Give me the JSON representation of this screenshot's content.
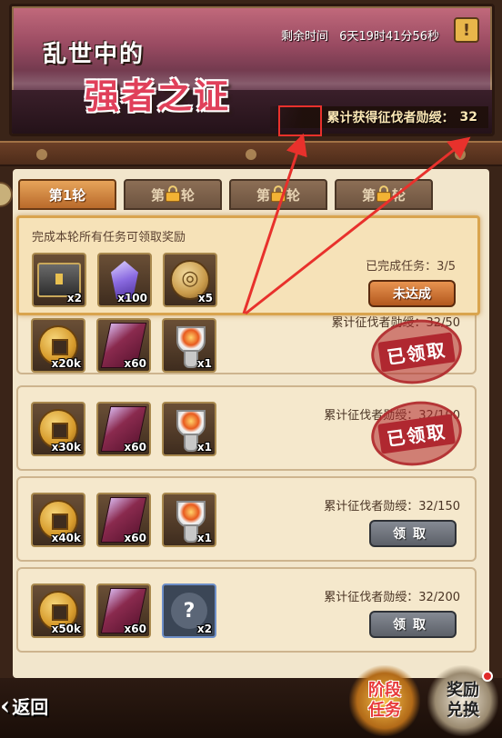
{
  "banner": {
    "title_line1": "乱世中的",
    "title_line2": "强者之证",
    "timer_label": "剩余时间",
    "timer_value": "6天19时41分56秒",
    "alert_icon": "!",
    "merit_label": "累计获得征伐者勋绶：",
    "merit_value": "32"
  },
  "tabs": [
    {
      "label": "第1轮",
      "locked": false
    },
    {
      "label": "第",
      "suffix": "轮",
      "locked": true
    },
    {
      "label": "第",
      "suffix": "轮",
      "locked": true
    },
    {
      "label": "第",
      "suffix": "轮",
      "locked": true
    }
  ],
  "summary": {
    "title": "完成本轮所有任务可领取奖励",
    "progress": "已完成任务：3/5",
    "button": "未达成",
    "items": [
      {
        "icon": "chest-icon",
        "qty": "x2"
      },
      {
        "icon": "crystal-icon",
        "qty": "x100"
      },
      {
        "icon": "token-icon",
        "qty": "x5"
      }
    ]
  },
  "tasks": [
    {
      "label": "累计征伐者勋绶：32/50",
      "status": "claimed",
      "stamp": "已领取",
      "items": [
        {
          "icon": "coin-icon",
          "qty": "x20k"
        },
        {
          "icon": "scroll-icon",
          "qty": "x60"
        },
        {
          "icon": "cup-icon",
          "qty": "x1"
        }
      ]
    },
    {
      "label": "累计征伐者勋绶：32/100",
      "status": "claimed",
      "stamp": "已领取",
      "items": [
        {
          "icon": "coin-icon",
          "qty": "x30k"
        },
        {
          "icon": "scroll-icon",
          "qty": "x60"
        },
        {
          "icon": "cup-icon",
          "qty": "x1"
        }
      ]
    },
    {
      "label": "累计征伐者勋绶：32/150",
      "status": "locked",
      "button": "领取",
      "items": [
        {
          "icon": "coin-icon",
          "qty": "x40k"
        },
        {
          "icon": "scroll-icon",
          "qty": "x60"
        },
        {
          "icon": "cup-icon",
          "qty": "x1"
        }
      ]
    },
    {
      "label": "累计征伐者勋绶：32/200",
      "status": "locked",
      "button": "领取",
      "items": [
        {
          "icon": "coin-icon",
          "qty": "x50k"
        },
        {
          "icon": "scroll-icon",
          "qty": "x60"
        },
        {
          "icon": "mystery-icon",
          "qty": "x2"
        }
      ]
    }
  ],
  "bottom": {
    "back": "返回",
    "stage_tasks": "阶段任务",
    "exchange": "奖励兑换"
  },
  "colors": {
    "annotation_red": "#e8312c",
    "accent_orange": "#b2581e",
    "panel_bg": "#f2e6cc"
  }
}
